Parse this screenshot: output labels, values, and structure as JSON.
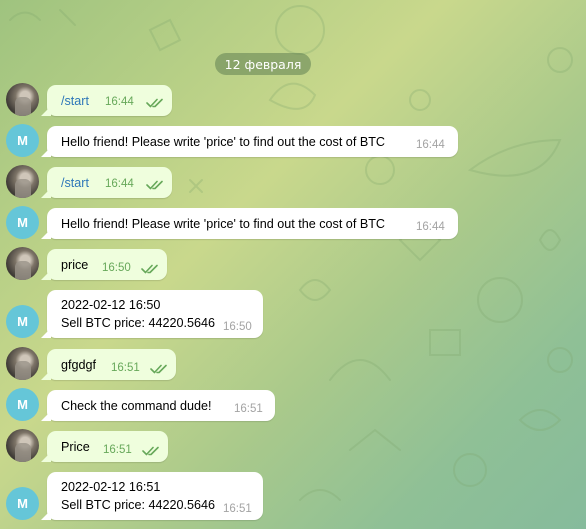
{
  "date_separator": "12 февраля",
  "messages": [
    {
      "dir": "out",
      "text": "/start",
      "time": "16:44",
      "is_command": true
    },
    {
      "dir": "in",
      "text": "Hello friend! Please write 'price' to find out the cost of BTC",
      "time": "16:44",
      "avatar_letter": "M"
    },
    {
      "dir": "out",
      "text": "/start",
      "time": "16:44",
      "is_command": true
    },
    {
      "dir": "in",
      "text": "Hello friend! Please write 'price' to find out the cost of BTC",
      "time": "16:44",
      "avatar_letter": "M"
    },
    {
      "dir": "out",
      "text": "price",
      "time": "16:50"
    },
    {
      "dir": "in",
      "text": "2022-02-12 16:50\nSell BTC price: 44220.5646",
      "time": "16:50",
      "avatar_letter": "M"
    },
    {
      "dir": "out",
      "text": "gfgdgf",
      "time": "16:51"
    },
    {
      "dir": "in",
      "text": "Check the command dude!",
      "time": "16:51",
      "avatar_letter": "M"
    },
    {
      "dir": "out",
      "text": "Price",
      "time": "16:51"
    },
    {
      "dir": "in",
      "text": "2022-02-12 16:51\nSell BTC price: 44220.5646",
      "time": "16:51",
      "avatar_letter": "M"
    }
  ],
  "colors": {
    "outgoing_bubble": "#effedd",
    "incoming_bubble": "#ffffff",
    "command_link": "#2e77b9",
    "outgoing_time": "#67a85a",
    "bot_avatar": "#65c6d8"
  },
  "icons": {
    "read_receipt": "double-check-icon",
    "user_avatar": "user-photo-avatar",
    "bot_avatar": "letter-avatar"
  }
}
